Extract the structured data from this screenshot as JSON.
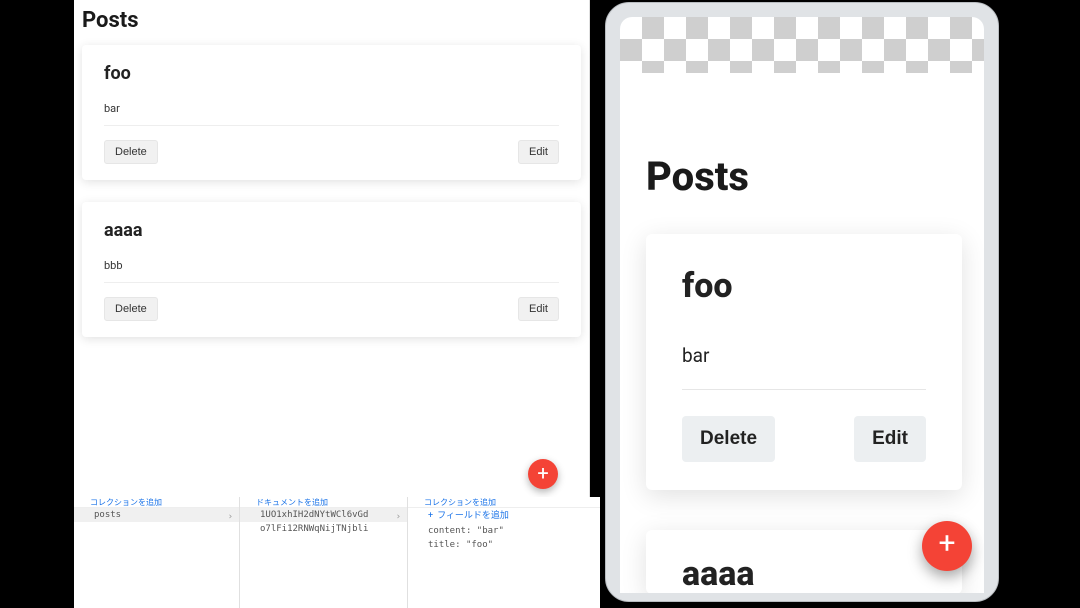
{
  "left": {
    "title": "Posts",
    "posts": [
      {
        "title": "foo",
        "body": "bar",
        "delete": "Delete",
        "edit": "Edit"
      },
      {
        "title": "aaaa",
        "body": "bbb",
        "delete": "Delete",
        "edit": "Edit"
      }
    ],
    "fab": "+"
  },
  "db": {
    "col1": {
      "header": "コレクションを追加",
      "rows": [
        "posts"
      ]
    },
    "col2": {
      "header": "ドキュメントを追加",
      "rows": [
        "1UO1xhIH2dNYtWCl6vGd",
        "o7lFi12RNWqNijTNjbli"
      ]
    },
    "col3": {
      "header": "コレクションを追加",
      "addField": "フィールドを追加",
      "fields": [
        {
          "key": "content",
          "value": "\"bar\""
        },
        {
          "key": "title",
          "value": "\"foo\""
        }
      ]
    }
  },
  "mobile": {
    "title": "Posts",
    "posts": [
      {
        "title": "foo",
        "body": "bar",
        "delete": "Delete",
        "edit": "Edit"
      },
      {
        "title": "aaaa"
      }
    ],
    "fab": "+"
  }
}
